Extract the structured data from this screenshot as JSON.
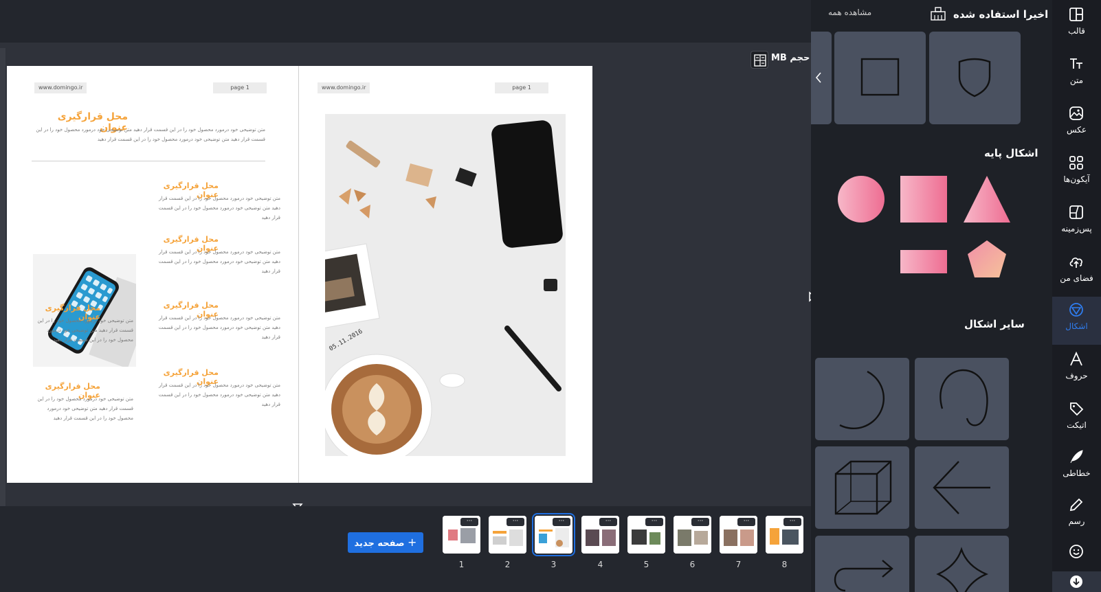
{
  "workspace": {
    "size_label": "حجم MB"
  },
  "document": {
    "left_page": {
      "url_chip": "www.domingo.ir",
      "page_chip": "page 1",
      "title": "محل قرارگیری عنوان",
      "intro_text": "متن توضیحی خود درمورد محصول خود را در این قسمت قرار دهید متن توضیحی خود درمورد محصول خود را در این قسمت قرار دهید متن توضیحی خود درمورد محصول خود را در این قسمت قرار دهید",
      "section_title": "محل قرارگیری عنوان",
      "section_text": "متن توضیحی خود درمورد محصول خود را در این قسمت قرار دهید متن توضیحی خود درمورد محصول خود را در این قسمت قرار دهید"
    },
    "right_page": {
      "url_chip": "www.domingo.ir",
      "page_chip": "page 1",
      "photo_date": "05.11.2016"
    }
  },
  "pages_strip": {
    "new_page_label": "صفحه جدید",
    "dots": "···",
    "pages": [
      "1",
      "2",
      "3",
      "4",
      "5",
      "6",
      "7",
      "8"
    ],
    "active_page": "3"
  },
  "panel": {
    "recent_title": "اخیرا استفاده شده",
    "see_all": "مشاهده همه",
    "basic_title": "اشکال پایه",
    "other_title": "سایر اشکال"
  },
  "sidebar": {
    "items": [
      {
        "label": "قالب",
        "icon": "layout-icon"
      },
      {
        "label": "متن",
        "icon": "text-icon"
      },
      {
        "label": "عکس",
        "icon": "image-icon"
      },
      {
        "label": "آیکون‌ها",
        "icon": "grid-icon"
      },
      {
        "label": "پس‌زمینه",
        "icon": "background-icon"
      },
      {
        "label": "فضای من",
        "icon": "cloud-upload-icon"
      },
      {
        "label": "اشکال",
        "icon": "shapes-icon"
      },
      {
        "label": "حروف",
        "icon": "letter-a-icon"
      },
      {
        "label": "اتیکت",
        "icon": "tag-icon"
      },
      {
        "label": "خطاطی",
        "icon": "feather-icon"
      },
      {
        "label": "رسم",
        "icon": "pencil-icon"
      }
    ],
    "active": "اشکال"
  },
  "colors": {
    "accent": "#1f6fe0",
    "title_orange": "#f5a33a",
    "pink_gradient_start": "#f7b7c8",
    "pink_gradient_end": "#ee6d92",
    "card_bg": "#4a5160"
  }
}
